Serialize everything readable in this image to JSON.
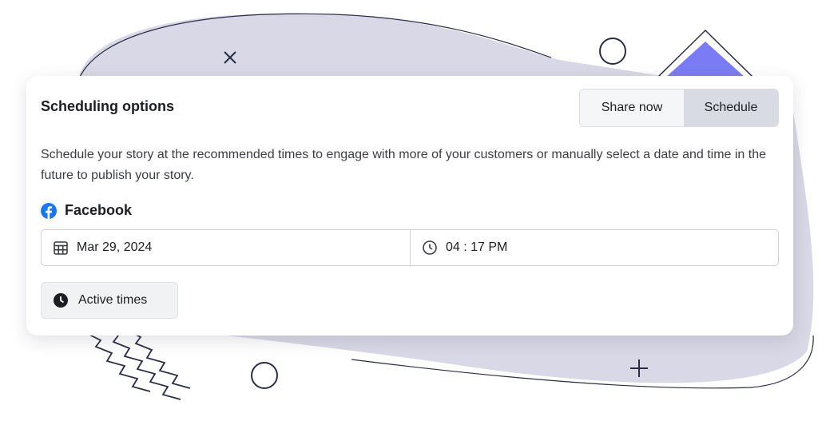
{
  "header": {
    "title": "Scheduling options"
  },
  "mode_toggle": {
    "options": [
      "Share now",
      "Schedule"
    ],
    "selected": "Schedule"
  },
  "description": "Schedule your story at the recommended times to engage with more of your customers or manually select a date and time in the future to publish your story.",
  "platform": {
    "icon": "facebook-icon",
    "label": "Facebook"
  },
  "date_field": {
    "icon": "calendar-icon",
    "value": "Mar 29, 2024"
  },
  "time_field": {
    "icon": "clock-icon",
    "value": "04 : 17 PM"
  },
  "active_times_button": {
    "icon": "clock-filled-icon",
    "label": "Active times"
  },
  "colors": {
    "facebook_blue": "#1877f2",
    "blob": "#d8d8e6",
    "triangle_accent": "#7b7cf5",
    "selected_toggle": "#d8dae4"
  }
}
